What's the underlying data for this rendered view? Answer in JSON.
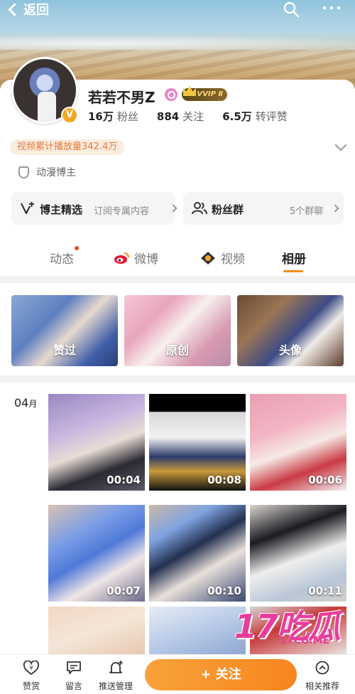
{
  "topbar": {
    "back_label": "返回"
  },
  "profile": {
    "name": "若若不男Z",
    "vip_badge": "VVIP Ⅱ",
    "verified_badge": "V",
    "stats": [
      {
        "value": "16万",
        "label": "粉丝"
      },
      {
        "value": "884",
        "label": "关注"
      },
      {
        "value": "6.5万",
        "label": "转评赞"
      }
    ],
    "play_count": "视频累计播放量342.4万",
    "tag": "动漫博主"
  },
  "panels": [
    {
      "title": "博主精选",
      "subtitle": "订阅专属内容"
    },
    {
      "title": "粉丝群",
      "subtitle": "5个群聊"
    }
  ],
  "tabs": [
    {
      "label": "动态",
      "has_dot": true
    },
    {
      "label": "微博"
    },
    {
      "label": "视频"
    },
    {
      "label": "相册",
      "active": true
    }
  ],
  "albums": [
    {
      "label": "赞过"
    },
    {
      "label": "原创"
    },
    {
      "label": "头像"
    }
  ],
  "month": {
    "num": "04",
    "unit": "月"
  },
  "videos": [
    {
      "duration": "00:04"
    },
    {
      "duration": "00:08"
    },
    {
      "duration": "00:06"
    },
    {
      "duration": "00:07"
    },
    {
      "duration": "00:10"
    },
    {
      "duration": "00:11"
    },
    {
      "duration": ""
    },
    {
      "duration": ""
    },
    {
      "duration": ""
    }
  ],
  "watermark": {
    "big": "17吃瓜",
    "small": "17CG.ME"
  },
  "bottombar": {
    "items": [
      {
        "label": "赞赏",
        "icon": "yen-icon"
      },
      {
        "label": "留言",
        "icon": "comment-icon"
      },
      {
        "label": "推送管理",
        "icon": "bell-icon"
      },
      {
        "label": "相关推荐",
        "icon": "up-circle-icon"
      }
    ],
    "follow_label": "+ 关注"
  },
  "colors": {
    "accent": "#f68b1f",
    "vip_gold": "#ffd77a",
    "watermark": "#e83d9b"
  }
}
